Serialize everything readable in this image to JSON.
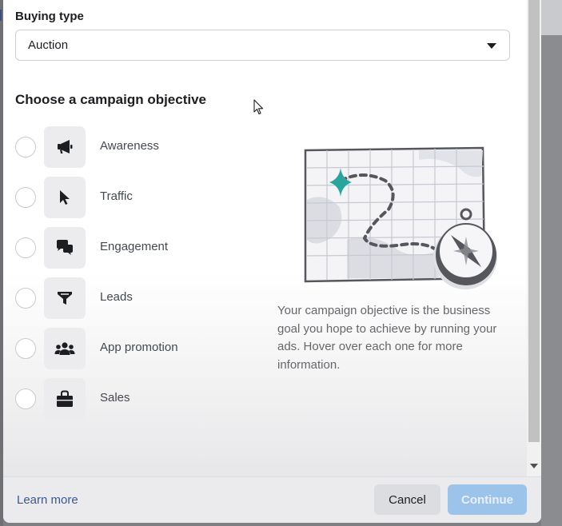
{
  "buying_type": {
    "label": "Buying type",
    "selected": "Auction"
  },
  "objective_section": {
    "title": "Choose a campaign objective",
    "options": [
      {
        "label": "Awareness",
        "icon": "megaphone-icon"
      },
      {
        "label": "Traffic",
        "icon": "cursor-arrow-icon"
      },
      {
        "label": "Engagement",
        "icon": "chat-bubbles-icon"
      },
      {
        "label": "Leads",
        "icon": "funnel-icon"
      },
      {
        "label": "App promotion",
        "icon": "people-group-icon"
      },
      {
        "label": "Sales",
        "icon": "shopping-bag-icon"
      }
    ],
    "help_text": "Your campaign objective is the business goal you hope to achieve by running your ads. Hover over each one for more information.",
    "illustration": "map-with-compass-illustration"
  },
  "footer": {
    "learn_more": "Learn more",
    "cancel": "Cancel",
    "continue": "Continue"
  },
  "colors": {
    "accent": "#385898",
    "continue_disabled": "#9cc3ea",
    "teal_star": "#2aa59e"
  }
}
